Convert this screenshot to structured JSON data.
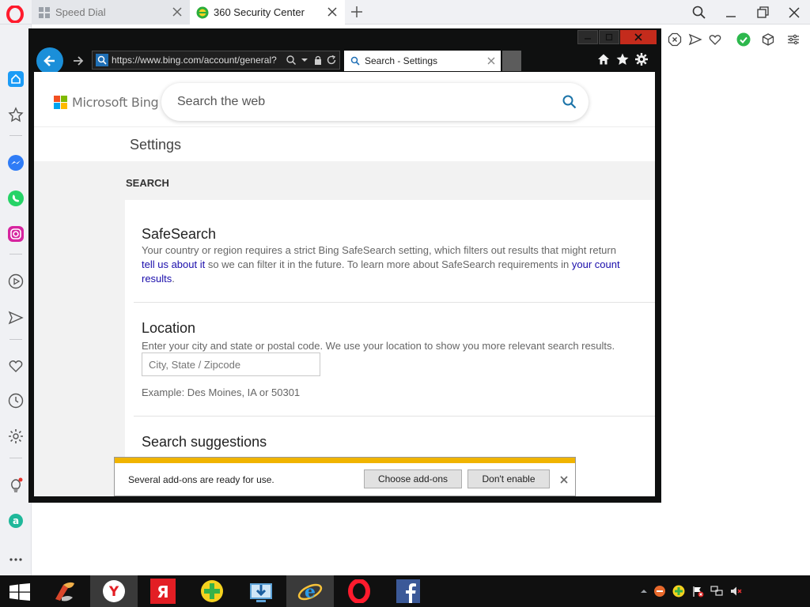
{
  "opera": {
    "tabs": [
      {
        "title": "Speed Dial"
      },
      {
        "title": "360 Security Center"
      }
    ]
  },
  "ie": {
    "address_url": "https://www.bing.com/account/general?",
    "tab_title": "Search - Settings"
  },
  "bing": {
    "logo_text": "Microsoft Bing",
    "search_placeholder": "Search the web"
  },
  "settings": {
    "title": "Settings",
    "section_heading": "SEARCH",
    "safesearch": {
      "title": "SafeSearch",
      "line1": "Your country or region requires a strict Bing SafeSearch setting, which filters out results that might return",
      "link1": "tell us about it",
      "line2_mid": " so we can filter it in the future. To learn more about SafeSearch requirements in ",
      "link2": "your count",
      "link3": "results",
      "line3_end": "."
    },
    "location": {
      "title": "Location",
      "desc": "Enter your city and state or postal code. We use your location to show you more relevant search results.",
      "input_placeholder": "City, State / Zipcode",
      "example": "Example: Des Moines, IA or 50301"
    },
    "search_suggestions": {
      "title": "Search suggestions"
    }
  },
  "notification": {
    "message": "Several add-ons are ready for use.",
    "choose_label": "Choose add-ons",
    "dont_enable_label": "Don't enable"
  },
  "colors": {
    "notify_stripe": "#f0b400",
    "ie_back": "#1b8fd9",
    "link": "#1a0dab"
  }
}
